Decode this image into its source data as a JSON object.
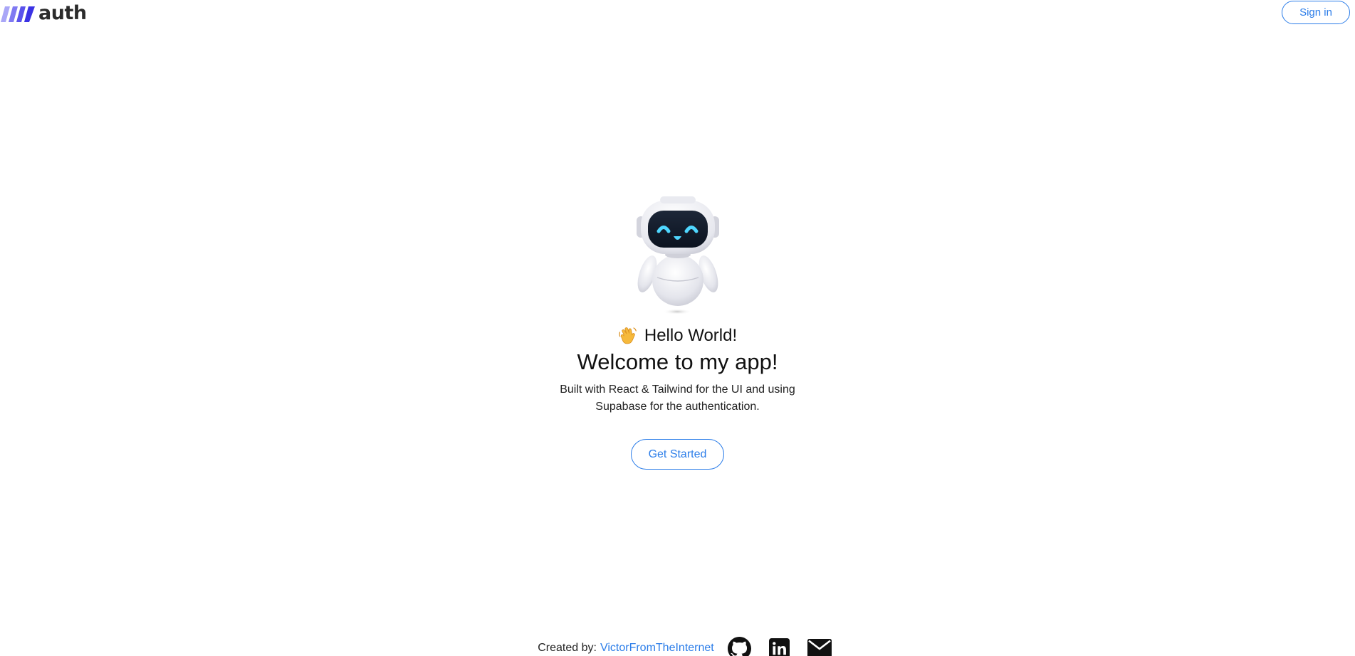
{
  "header": {
    "logo_text": "auth",
    "signin_label": "Sign in"
  },
  "hero": {
    "greeting": "Hello World!",
    "title": "Welcome to my app!",
    "description": "Built with React & Tailwind for the UI and using Supabase for the authentication.",
    "cta_label": "Get Started"
  },
  "footer": {
    "credit_label": "Created by:",
    "credit_name": "VictorFromTheInternet",
    "social": [
      "github-icon",
      "linkedin-icon",
      "mail-icon"
    ]
  },
  "colors": {
    "accent": "#2b7de9",
    "logo_mark": "#5b4ff0",
    "text": "#111111"
  }
}
